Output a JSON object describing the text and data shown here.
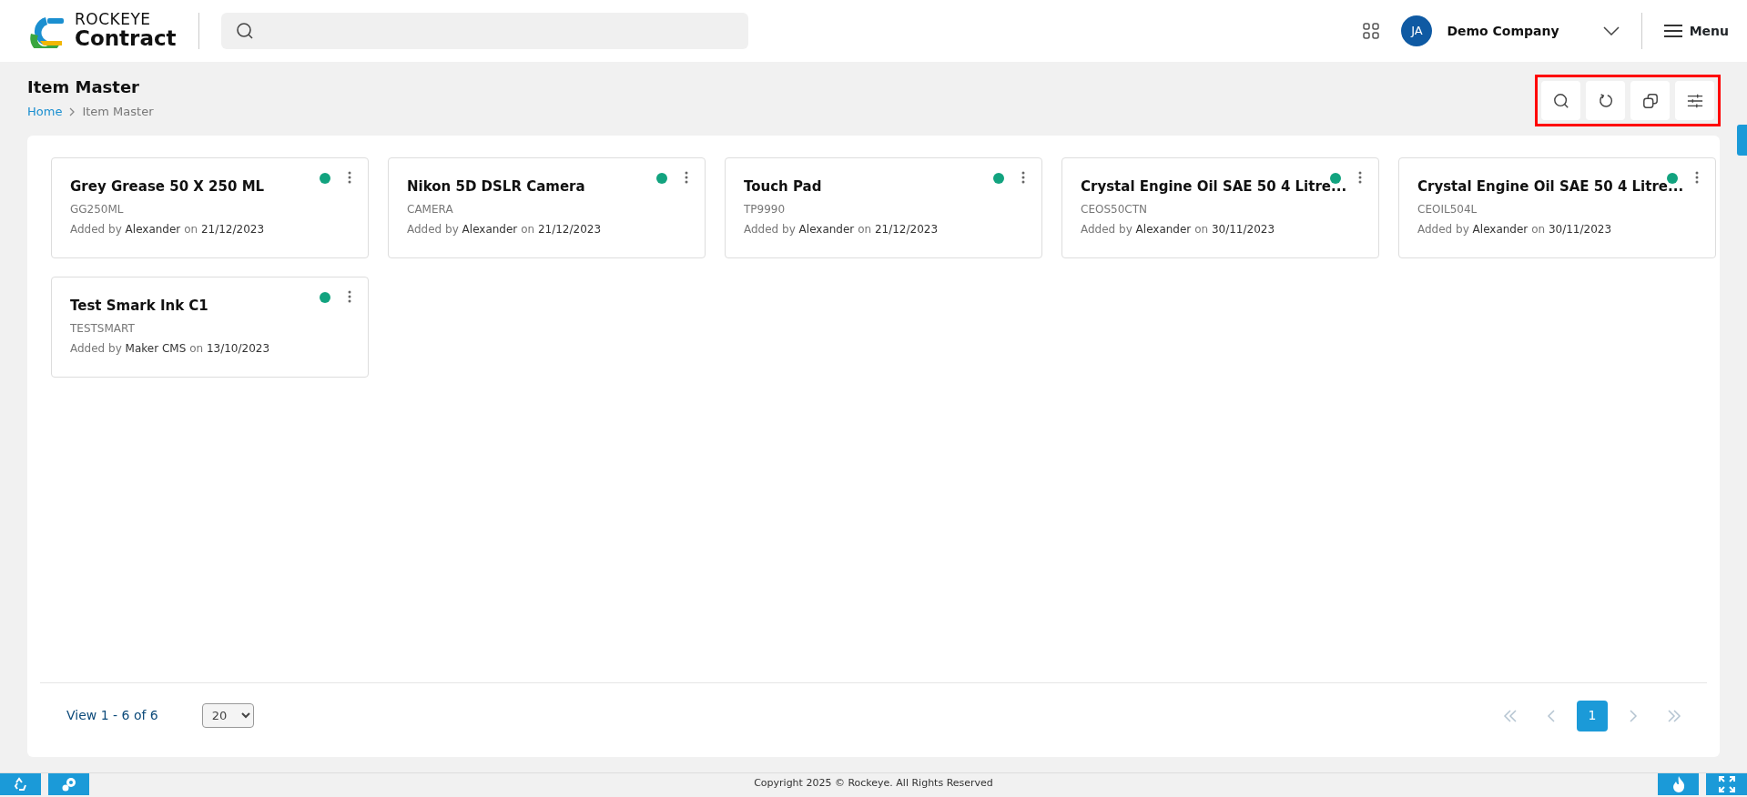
{
  "header": {
    "logo_line1": "ROCKEYE",
    "logo_line2": "Contract",
    "avatar_initials": "JA",
    "company": "Demo Company",
    "menu_label": "Menu"
  },
  "page": {
    "title": "Item Master",
    "breadcrumb": [
      {
        "label": "Home",
        "link": true
      },
      {
        "label": "Item Master",
        "link": false
      }
    ],
    "toolbar_highlighted": true
  },
  "items": [
    {
      "name": "Grey Grease 50 X 250 ML",
      "code": "GG250ML",
      "added_by_label": "Added by",
      "user": "Alexander",
      "on_label": "on",
      "date": "21/12/2023",
      "active": true
    },
    {
      "name": "Nikon 5D DSLR Camera",
      "code": "CAMERA",
      "added_by_label": "Added by",
      "user": "Alexander",
      "on_label": "on",
      "date": "21/12/2023",
      "active": true
    },
    {
      "name": "Touch Pad",
      "code": "TP9990",
      "added_by_label": "Added by",
      "user": "Alexander",
      "on_label": "on",
      "date": "21/12/2023",
      "active": true
    },
    {
      "name": "Crystal Engine Oil SAE 50 4 Litre...",
      "code": "CEOS50CTN",
      "added_by_label": "Added by",
      "user": "Alexander",
      "on_label": "on",
      "date": "30/11/2023",
      "active": true
    },
    {
      "name": "Crystal Engine Oil SAE 50 4 Litre...",
      "code": "CEOIL504L",
      "added_by_label": "Added by",
      "user": "Alexander",
      "on_label": "on",
      "date": "30/11/2023",
      "active": true
    },
    {
      "name": "Test Smark Ink C1",
      "code": "TESTSMART",
      "added_by_label": "Added by",
      "user": "Maker CMS",
      "on_label": "on",
      "date": "13/10/2023",
      "active": true
    }
  ],
  "pagination": {
    "summary": "View 1 - 6 of 6",
    "page_size": "20",
    "pages": [
      {
        "label": "1",
        "selected": true
      }
    ]
  },
  "footer": {
    "copyright": "Copyright 2025 © Rockeye. All Rights Reserved"
  }
}
